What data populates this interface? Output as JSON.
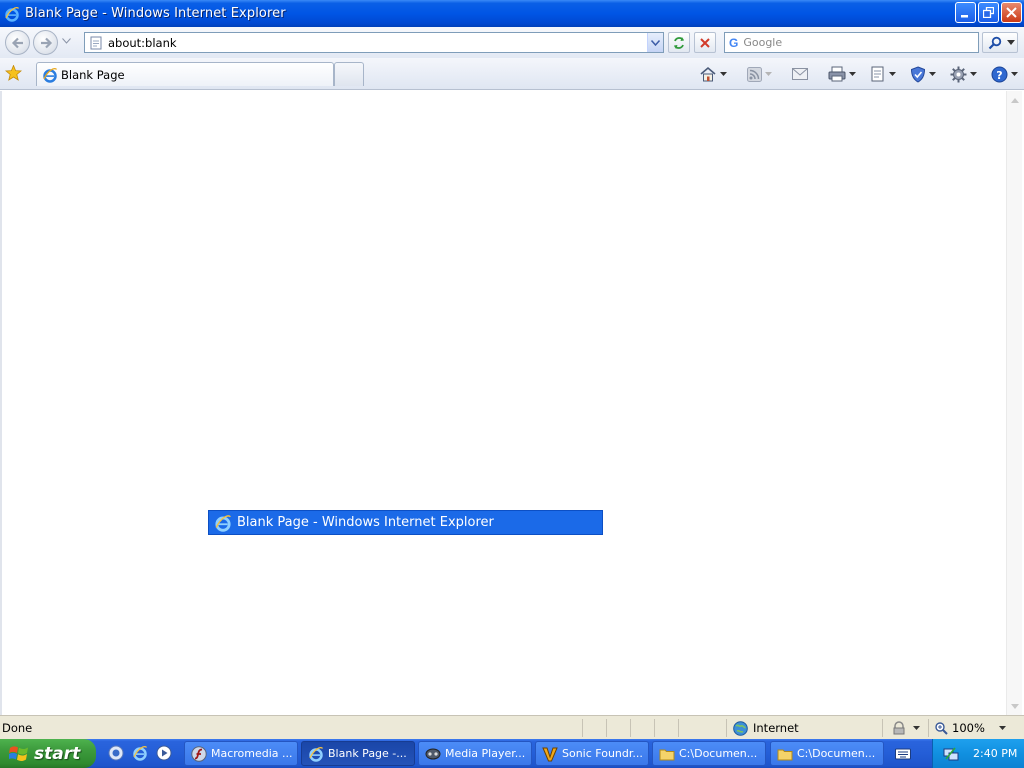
{
  "window": {
    "title": "Blank Page - Windows Internet Explorer"
  },
  "address_bar": {
    "url": "about:blank"
  },
  "search": {
    "provider_logo": "G",
    "placeholder": "Google"
  },
  "tabs": [
    {
      "label": "Blank Page"
    }
  ],
  "switcher": {
    "label": "Blank Page - Windows Internet Explorer"
  },
  "status": {
    "text": "Done",
    "zone": "Internet",
    "zoom": "100%"
  },
  "taskbar": {
    "start_label": "start",
    "buttons": [
      {
        "label": "Macromedia ...",
        "icon": "flash-icon"
      },
      {
        "label": "Blank Page -...",
        "icon": "ie-icon",
        "active": true
      },
      {
        "label": "Media Player...",
        "icon": "media-player-icon"
      },
      {
        "label": "Sonic Foundr...",
        "icon": "vegas-icon"
      },
      {
        "label": "C:\\Documen...",
        "icon": "folder-icon"
      },
      {
        "label": "C:\\Documen...",
        "icon": "folder-icon"
      }
    ],
    "clock": "2:40 PM"
  },
  "colors": {
    "titlebar": "#0055e5",
    "taskbar": "#245ed7",
    "start": "#3c9a3c",
    "switcher": "#1b6ae8"
  }
}
